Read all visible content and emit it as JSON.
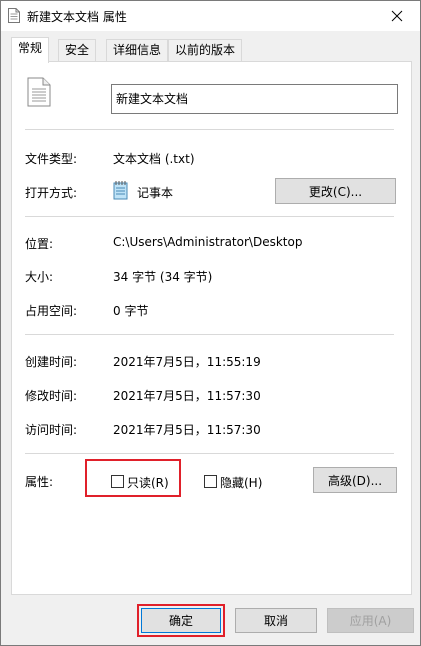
{
  "window": {
    "title": "新建文本文档 属性"
  },
  "tabs": [
    {
      "label": "常规",
      "active": true
    },
    {
      "label": "安全",
      "active": false
    },
    {
      "label": "详细信息",
      "active": false
    },
    {
      "label": "以前的版本",
      "active": false
    }
  ],
  "general": {
    "file_name": "新建文本文档",
    "file_type_label": "文件类型:",
    "file_type_value": "文本文档 (.txt)",
    "open_with_label": "打开方式:",
    "open_with_value": "记事本",
    "change_button": "更改(C)...",
    "location_label": "位置:",
    "location_value": "C:\\Users\\Administrator\\Desktop",
    "size_label": "大小:",
    "size_value": "34 字节 (34 字节)",
    "size_on_disk_label": "占用空间:",
    "size_on_disk_value": "0 字节",
    "created_label": "创建时间:",
    "created_value": "2021年7月5日，11:55:19",
    "modified_label": "修改时间:",
    "modified_value": "2021年7月5日，11:57:30",
    "accessed_label": "访问时间:",
    "accessed_value": "2021年7月5日，11:57:30",
    "attributes_label": "属性:",
    "readonly_label": "只读(R)",
    "readonly_checked": false,
    "hidden_label": "隐藏(H)",
    "hidden_checked": false,
    "advanced_button": "高级(D)..."
  },
  "footer": {
    "ok_button": "确定",
    "cancel_button": "取消",
    "apply_button": "应用(A)"
  },
  "colors": {
    "highlight": "#e0202a",
    "window_bg": "#f0f0f0",
    "panel_bg": "#ffffff"
  }
}
